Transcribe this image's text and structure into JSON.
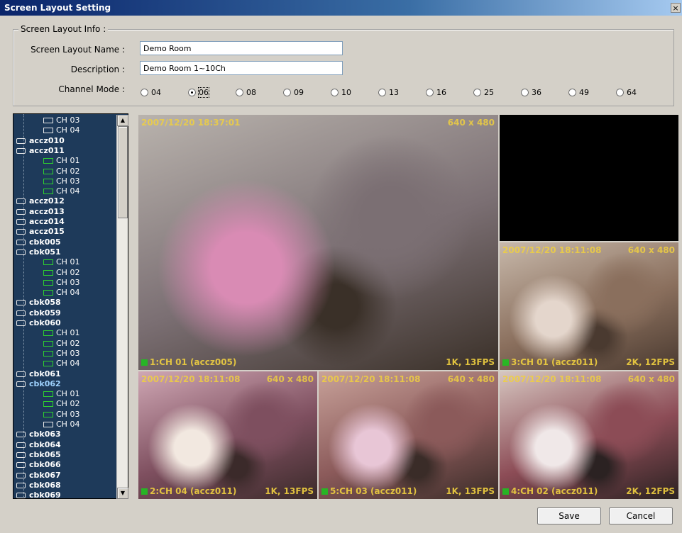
{
  "window": {
    "title": "Screen Layout Setting",
    "close_glyph": "×"
  },
  "info": {
    "legend": "Screen Layout Info :",
    "name_label": "Screen Layout Name :",
    "name_value": "Demo Room",
    "desc_label": "Description :",
    "desc_value": "Demo Room 1~10Ch",
    "mode_label": "Channel Mode :",
    "modes": [
      "04",
      "06",
      "08",
      "09",
      "10",
      "13",
      "16",
      "25",
      "36",
      "49",
      "64"
    ],
    "selected_mode": "06"
  },
  "tree": {
    "rows": [
      {
        "type": "channel",
        "label": "CH 03",
        "icon": "camera-icon-white"
      },
      {
        "type": "channel",
        "label": "CH 04",
        "icon": "camera-icon-white"
      },
      {
        "type": "dvr",
        "label": "accz010",
        "icon": "dvr-icon"
      },
      {
        "type": "dvr",
        "label": "accz011",
        "icon": "dvr-icon"
      },
      {
        "type": "channel",
        "label": "CH 01",
        "icon": "camera-icon"
      },
      {
        "type": "channel",
        "label": "CH 02",
        "icon": "camera-icon"
      },
      {
        "type": "channel",
        "label": "CH 03",
        "icon": "camera-icon"
      },
      {
        "type": "channel",
        "label": "CH 04",
        "icon": "camera-icon"
      },
      {
        "type": "dvr",
        "label": "accz012",
        "icon": "dvr-icon"
      },
      {
        "type": "dvr",
        "label": "accz013",
        "icon": "dvr-icon"
      },
      {
        "type": "dvr",
        "label": "accz014",
        "icon": "dvr-icon"
      },
      {
        "type": "dvr",
        "label": "accz015",
        "icon": "dvr-icon"
      },
      {
        "type": "dvr",
        "label": "cbk005",
        "icon": "dvr-icon"
      },
      {
        "type": "dvr",
        "label": "cbk051",
        "icon": "dvr-icon"
      },
      {
        "type": "channel",
        "label": "CH 01",
        "icon": "camera-icon"
      },
      {
        "type": "channel",
        "label": "CH 02",
        "icon": "camera-icon"
      },
      {
        "type": "channel",
        "label": "CH 03",
        "icon": "camera-icon"
      },
      {
        "type": "channel",
        "label": "CH 04",
        "icon": "camera-icon"
      },
      {
        "type": "dvr",
        "label": "cbk058",
        "icon": "dvr-icon"
      },
      {
        "type": "dvr",
        "label": "cbk059",
        "icon": "dvr-icon"
      },
      {
        "type": "dvr",
        "label": "cbk060",
        "icon": "dvr-icon"
      },
      {
        "type": "channel",
        "label": "CH 01",
        "icon": "camera-icon"
      },
      {
        "type": "channel",
        "label": "CH 02",
        "icon": "camera-icon"
      },
      {
        "type": "channel",
        "label": "CH 03",
        "icon": "camera-icon"
      },
      {
        "type": "channel",
        "label": "CH 04",
        "icon": "camera-icon"
      },
      {
        "type": "dvr",
        "label": "cbk061",
        "icon": "dvr-icon"
      },
      {
        "type": "dvr",
        "label": "cbk062",
        "icon": "dvr-icon",
        "selected": true
      },
      {
        "type": "channel",
        "label": "CH 01",
        "icon": "camera-icon"
      },
      {
        "type": "channel",
        "label": "CH 02",
        "icon": "camera-icon"
      },
      {
        "type": "channel",
        "label": "CH 03",
        "icon": "camera-icon"
      },
      {
        "type": "channel",
        "label": "CH 04",
        "icon": "camera-icon-disabled"
      },
      {
        "type": "dvr",
        "label": "cbk063",
        "icon": "dvr-icon"
      },
      {
        "type": "dvr",
        "label": "cbk064",
        "icon": "dvr-icon"
      },
      {
        "type": "dvr",
        "label": "cbk065",
        "icon": "dvr-icon"
      },
      {
        "type": "dvr",
        "label": "cbk066",
        "icon": "dvr-icon"
      },
      {
        "type": "dvr",
        "label": "cbk067",
        "icon": "dvr-icon"
      },
      {
        "type": "dvr",
        "label": "cbk068",
        "icon": "dvr-icon"
      },
      {
        "type": "dvr",
        "label": "cbk069",
        "icon": "dvr-icon"
      }
    ]
  },
  "cameras": [
    {
      "ts": "2007/12/20 18:37:01",
      "res": "640 x 480",
      "name": "1:CH 01 (accz005)",
      "fps": "1K, 13FPS",
      "palette": [
        "#b9b3ad",
        "#7b6f73",
        "#d98bb4",
        "#3a3028"
      ]
    },
    {
      "ts": "",
      "res": "",
      "name": "",
      "fps": "",
      "palette": [
        "#000000",
        "#000000",
        "#000000",
        "#000000"
      ]
    },
    {
      "ts": "2007/12/20 18:11:08",
      "res": "640 x 480",
      "name": "3:CH 01 (accz011)",
      "fps": "2K, 12FPS",
      "palette": [
        "#c7b8aa",
        "#8a6f5d",
        "#e4d6cc",
        "#4a3a30"
      ]
    },
    {
      "ts": "2007/12/20 18:11:08",
      "res": "640 x 480",
      "name": "2:CH 04 (accz011)",
      "fps": "1K, 13FPS",
      "palette": [
        "#cfa7b4",
        "#7e4f5f",
        "#f2e8e0",
        "#3b2a2a"
      ]
    },
    {
      "ts": "2007/12/20 18:11:08",
      "res": "640 x 480",
      "name": "5:CH 03 (accz011)",
      "fps": "1K, 13FPS",
      "palette": [
        "#c8a29a",
        "#8b5a5a",
        "#e8c6d6",
        "#3a2c28"
      ]
    },
    {
      "ts": "2007/12/20 18:11:08",
      "res": "640 x 480",
      "name": "4:CH 02 (accz011)",
      "fps": "2K, 12FPS",
      "palette": [
        "#d6c6c0",
        "#8c4c56",
        "#f0e8e8",
        "#2b2222"
      ]
    }
  ],
  "buttons": {
    "save": "Save",
    "cancel": "Cancel"
  },
  "colors": {
    "accent": "#0a246a",
    "overlay_text": "#f0d040",
    "channel_green": "#2ed02e",
    "tree_bg": "#1e3a5a"
  }
}
